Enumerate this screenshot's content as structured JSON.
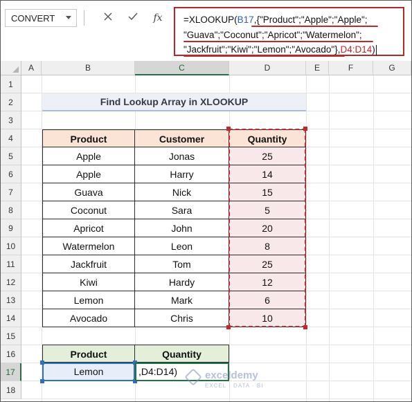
{
  "name_box": {
    "value": "CONVERT"
  },
  "formula_bar": {
    "cancel_icon": "close-icon",
    "enter_icon": "check-icon",
    "fx_label": "fx",
    "line1": {
      "a": "=XLOOKUP(",
      "b": "B17",
      "c": ",{",
      "d": "\"Product\";\"Apple\";\"Apple\";"
    },
    "line2": {
      "a": "\"Guava\";\"Coconut\";\"Apricot\";\"Watermelon\";"
    },
    "line3": {
      "a": "\"Jackfruit\";\"Kiwi\";\"Lemon\";\"Avocado\"",
      "b": "},",
      "c": "D4:D14",
      "d": ")"
    }
  },
  "columns": [
    "A",
    "B",
    "C",
    "D",
    "E",
    "F",
    "G"
  ],
  "active_column": "C",
  "rows": [
    "1",
    "2",
    "3",
    "4",
    "5",
    "6",
    "7",
    "8",
    "9",
    "10",
    "11",
    "12",
    "13",
    "14",
    "15",
    "16",
    "17",
    "18"
  ],
  "active_row": "17",
  "title": "Find Lookup Array in XLOOKUP",
  "table": {
    "headers": [
      "Product",
      "Customer",
      "Quantity"
    ],
    "rows": [
      [
        "Apple",
        "Jonas",
        "25"
      ],
      [
        "Apple",
        "Harry",
        "14"
      ],
      [
        "Guava",
        "Nick",
        "15"
      ],
      [
        "Coconut",
        "Sara",
        "5"
      ],
      [
        "Apricot",
        "John",
        "20"
      ],
      [
        "Watermelon",
        "Leon",
        "8"
      ],
      [
        "Jackfruit",
        "Tom",
        "25"
      ],
      [
        "Kiwi",
        "Hardy",
        "12"
      ],
      [
        "Lemon",
        "Mark",
        "6"
      ],
      [
        "Avocado",
        "Chris",
        "10"
      ]
    ]
  },
  "lookup": {
    "headers": [
      "Product",
      "Quantity"
    ],
    "product": "Lemon",
    "editing_text": ",D4:D14)"
  },
  "watermark": {
    "name": "exceldemy",
    "tagline": "EXCEL · DATA · BI"
  },
  "colors": {
    "header_fill": "#fbe3d5",
    "quantity_fill": "#f9e8ea",
    "lookup_header_fill": "#e3efd9",
    "reference_red": "#c0282d",
    "reference_blue": "#2a62c3",
    "excel_green": "#217346"
  }
}
